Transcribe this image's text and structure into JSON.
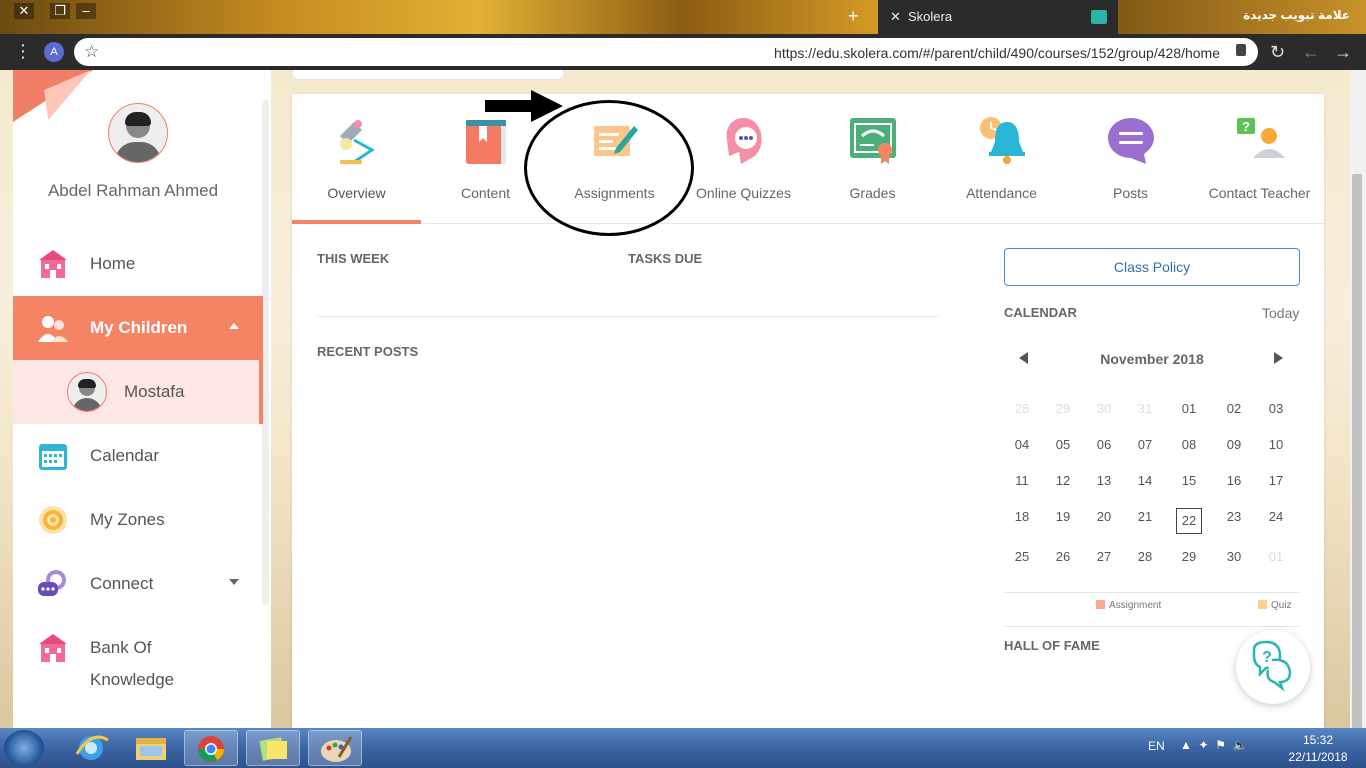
{
  "browser": {
    "tab_title": "Skolera",
    "other_tab_title": "علامة تبويب جديدة",
    "avatar_letter": "A",
    "url": "https://edu.skolera.com/#/parent/child/490/courses/152/group/428/home"
  },
  "sidebar": {
    "user_name": "Abdel Rahman Ahmed",
    "items": [
      {
        "label": "Home",
        "icon": "school-icon"
      },
      {
        "label": "My Children",
        "icon": "children-icon"
      },
      {
        "label": "Mostafa",
        "icon": "avatar"
      },
      {
        "label": "Calendar",
        "icon": "calendar-icon"
      },
      {
        "label": "My Zones",
        "icon": "zones-icon"
      },
      {
        "label": "Connect",
        "icon": "chat-icon"
      },
      {
        "label": "Bank Of",
        "label2": "Knowledge",
        "icon": "bank-icon"
      }
    ]
  },
  "course_tabs": [
    {
      "label": "Overview",
      "icon": "lamp-icon",
      "active": true
    },
    {
      "label": "Content",
      "icon": "book-icon"
    },
    {
      "label": "Assignments",
      "icon": "assignment-icon"
    },
    {
      "label": "Online Quizzes",
      "icon": "quiz-icon"
    },
    {
      "label": "Grades",
      "icon": "certificate-icon"
    },
    {
      "label": "Attendance",
      "icon": "bell-clock-icon"
    },
    {
      "label": "Posts",
      "icon": "posts-icon"
    },
    {
      "label": "Contact Teacher",
      "icon": "contact-teacher-icon"
    }
  ],
  "overview": {
    "this_week": "THIS WEEK",
    "tasks_due": "TASKS DUE",
    "recent_posts": "RECENT POSTS"
  },
  "right": {
    "class_policy": "Class Policy",
    "calendar_title": "CALENDAR",
    "today": "Today",
    "month": "November 2018",
    "weeks": [
      [
        "28",
        "29",
        "30",
        "31",
        "01",
        "02",
        "03"
      ],
      [
        "04",
        "05",
        "06",
        "07",
        "08",
        "09",
        "10"
      ],
      [
        "11",
        "12",
        "13",
        "14",
        "15",
        "16",
        "17"
      ],
      [
        "18",
        "19",
        "20",
        "21",
        "22",
        "23",
        "24"
      ],
      [
        "25",
        "26",
        "27",
        "28",
        "29",
        "30",
        "01"
      ]
    ],
    "selected_day": "22",
    "legend_assignment": "Assignment",
    "legend_quiz": "Quiz",
    "hall_of_fame": "HALL OF FAME",
    "colors": {
      "assignment": "#f9a98f",
      "quiz": "#fcd28b",
      "accent": "#f58465",
      "policy": "#3d8fd0"
    }
  },
  "taskbar": {
    "lang": "EN",
    "time": "15:32",
    "date": "22/11/2018"
  }
}
